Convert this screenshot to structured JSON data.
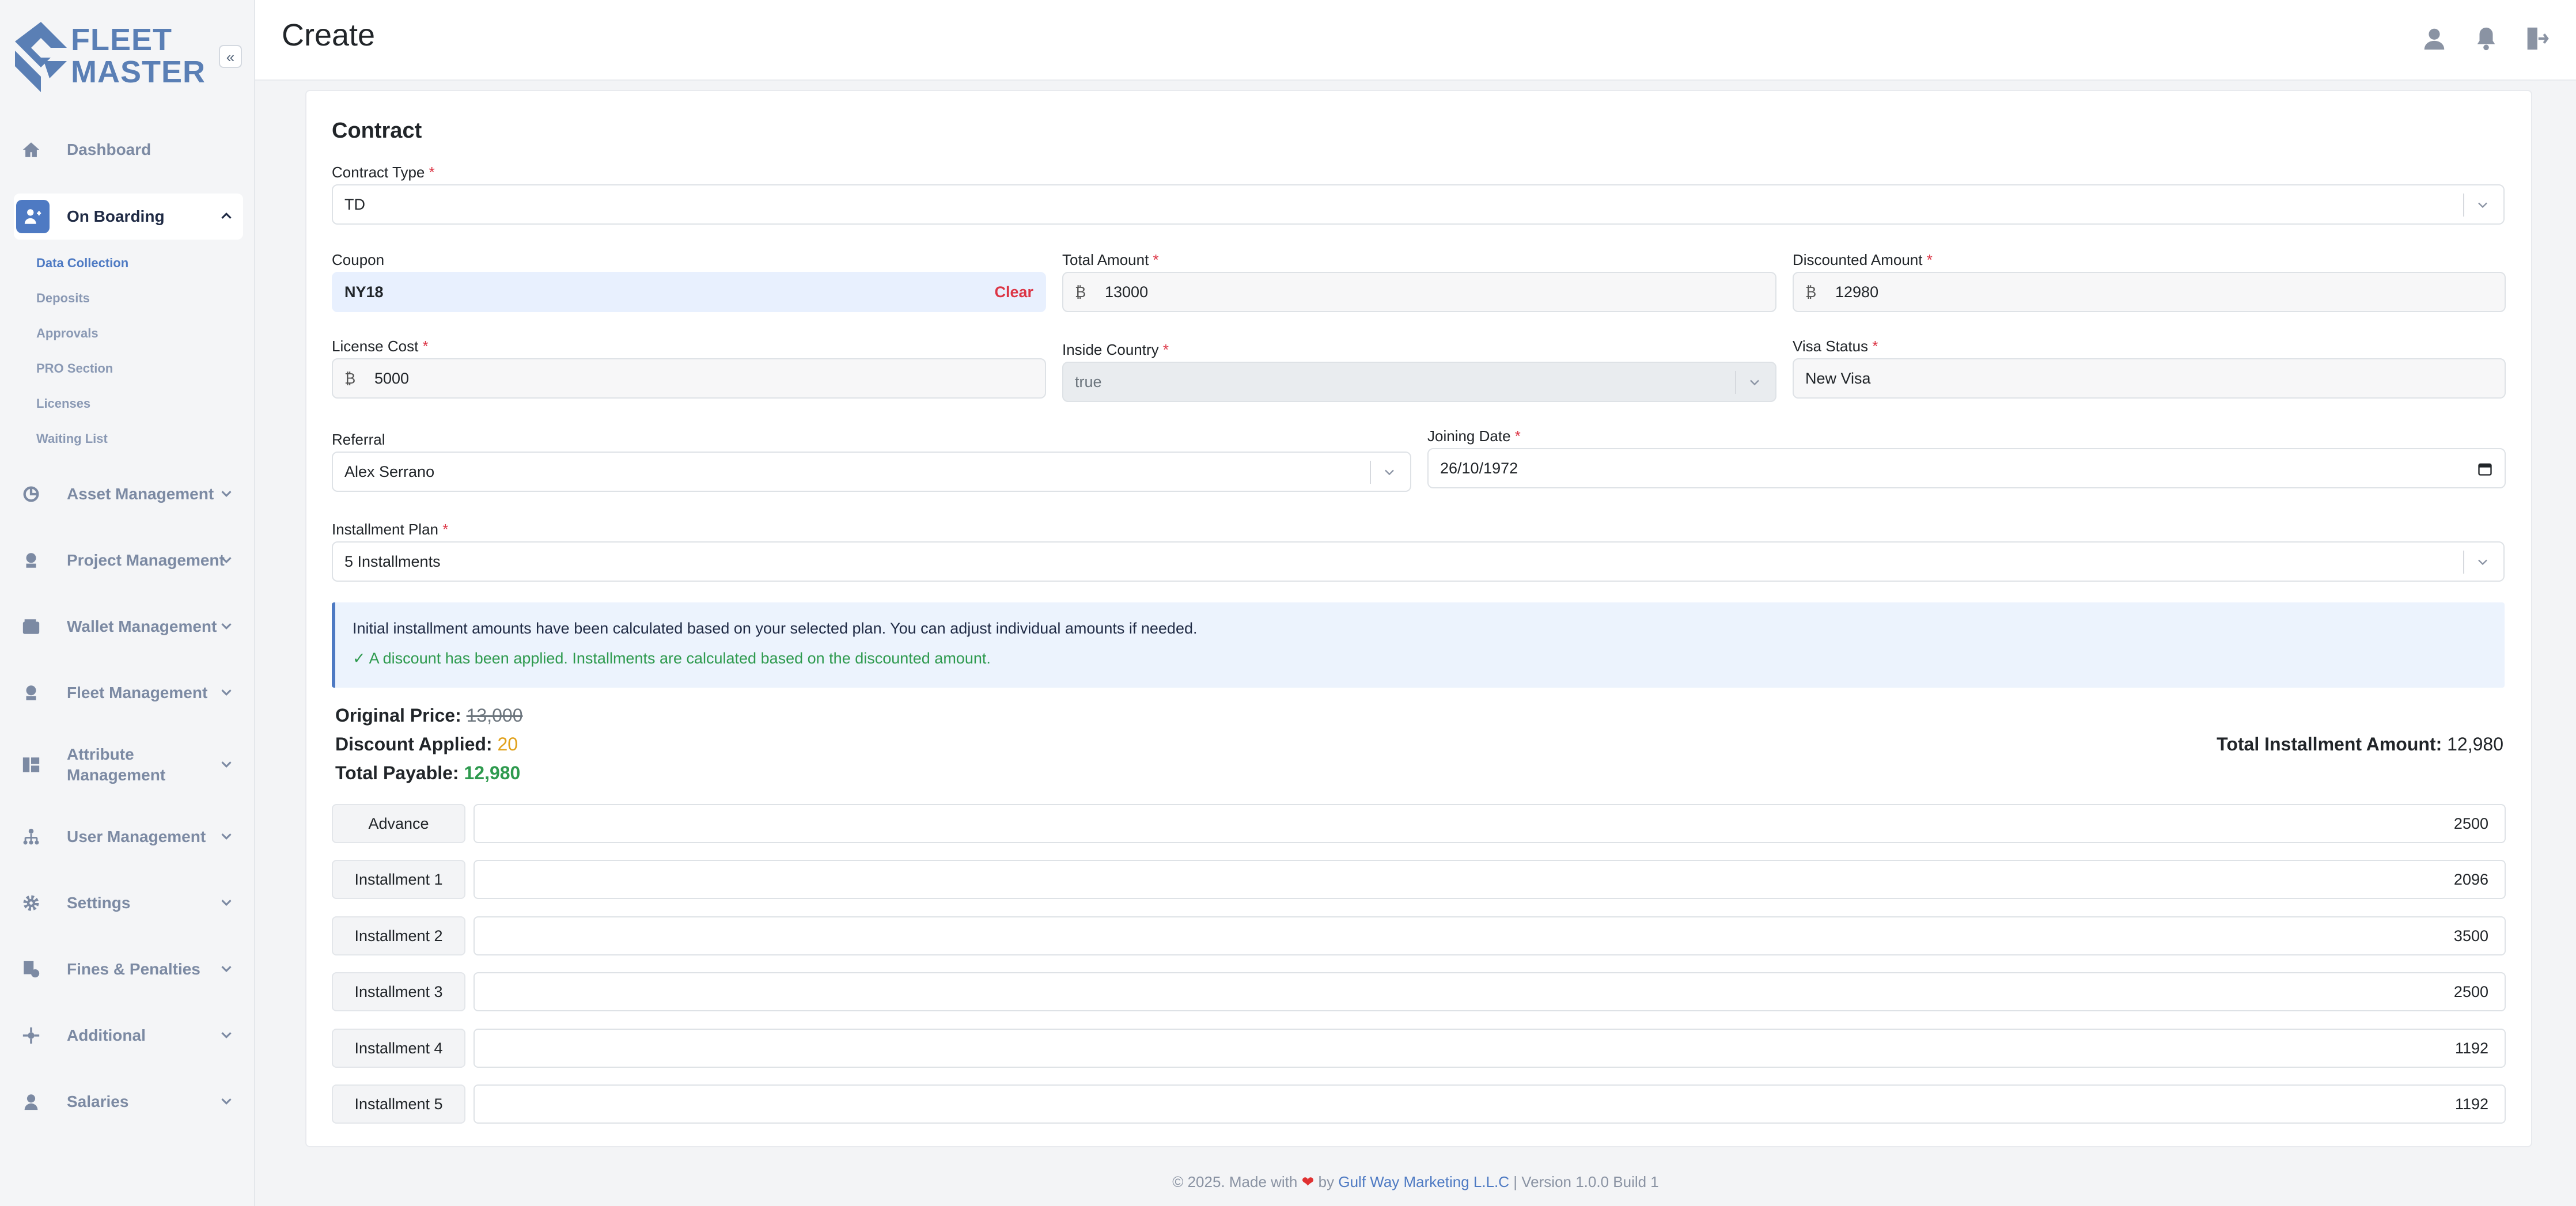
{
  "app": {
    "logo_line1": "FLEET",
    "logo_line2": "MASTER"
  },
  "header": {
    "title": "Create",
    "icons": [
      "user-icon",
      "bell-icon",
      "logout-icon"
    ]
  },
  "sidebar": {
    "items": [
      {
        "label": "Dashboard",
        "icon": "home-icon"
      },
      {
        "label": "On Boarding",
        "icon": "onboarding-icon",
        "expanded": true
      },
      {
        "label": "Asset Management",
        "icon": "asset-icon"
      },
      {
        "label": "Project Management",
        "icon": "project-icon"
      },
      {
        "label": "Wallet Management",
        "icon": "wallet-icon"
      },
      {
        "label": "Fleet Management",
        "icon": "fleet-icon"
      },
      {
        "label": "Attribute",
        "label2": "Management",
        "icon": "attribute-icon"
      },
      {
        "label": "User Management",
        "icon": "users-icon"
      },
      {
        "label": "Settings",
        "icon": "gear-icon"
      },
      {
        "label": "Fines & Penalties",
        "icon": "fines-icon"
      },
      {
        "label": "Additional",
        "icon": "additional-icon"
      },
      {
        "label": "Salaries",
        "icon": "salaries-icon"
      }
    ],
    "sub_items": [
      "Data Collection",
      "Deposits",
      "Approvals",
      "PRO Section",
      "Licenses",
      "Waiting List"
    ]
  },
  "form": {
    "section_title": "Contract",
    "contract_type": {
      "label": "Contract Type",
      "value": "TD"
    },
    "coupon": {
      "label": "Coupon",
      "value": "NY18",
      "clear": "Clear"
    },
    "total_amount": {
      "label": "Total Amount",
      "currency": "₿",
      "value": "13000"
    },
    "discounted_amount": {
      "label": "Discounted Amount",
      "currency": "₿",
      "value": "12980"
    },
    "license_cost": {
      "label": "License Cost",
      "currency": "₿",
      "value": "5000"
    },
    "inside_country": {
      "label": "Inside Country",
      "value": "true"
    },
    "visa_status": {
      "label": "Visa Status",
      "value": "New Visa"
    },
    "referral": {
      "label": "Referral",
      "value": "Alex Serrano"
    },
    "joining_date": {
      "label": "Joining Date",
      "value": "26/10/1972"
    },
    "installment_plan": {
      "label": "Installment Plan",
      "value": "5 Installments"
    },
    "required_mark": "*"
  },
  "alert": {
    "line1": "Initial installment amounts have been calculated based on your selected plan. You can adjust individual amounts if needed.",
    "line2": "A discount has been applied. Installments are calculated based on the discounted amount."
  },
  "summary": {
    "original_label": "Original Price:",
    "original_value": "13,000",
    "discount_label": "Discount Applied:",
    "discount_value": "20",
    "payable_label": "Total Payable:",
    "payable_value": "12,980",
    "total_inst_label": "Total Installment Amount:",
    "total_inst_value": "12,980"
  },
  "installments": [
    {
      "label": "Advance",
      "value": "2500"
    },
    {
      "label": "Installment 1",
      "value": "2096"
    },
    {
      "label": "Installment 2",
      "value": "3500"
    },
    {
      "label": "Installment 3",
      "value": "2500"
    },
    {
      "label": "Installment 4",
      "value": "1192"
    },
    {
      "label": "Installment 5",
      "value": "1192"
    }
  ],
  "footer": {
    "prefix": "© 2025. Made with",
    "heart": "❤",
    "by": "by",
    "company": "Gulf Way Marketing L.L.C",
    "version": "| Version 1.0.0 Build 1"
  },
  "colors": {
    "accent": "#4e7ac3",
    "danger": "#dc3545",
    "success": "#2e9a4e",
    "warning": "#e0a019"
  }
}
